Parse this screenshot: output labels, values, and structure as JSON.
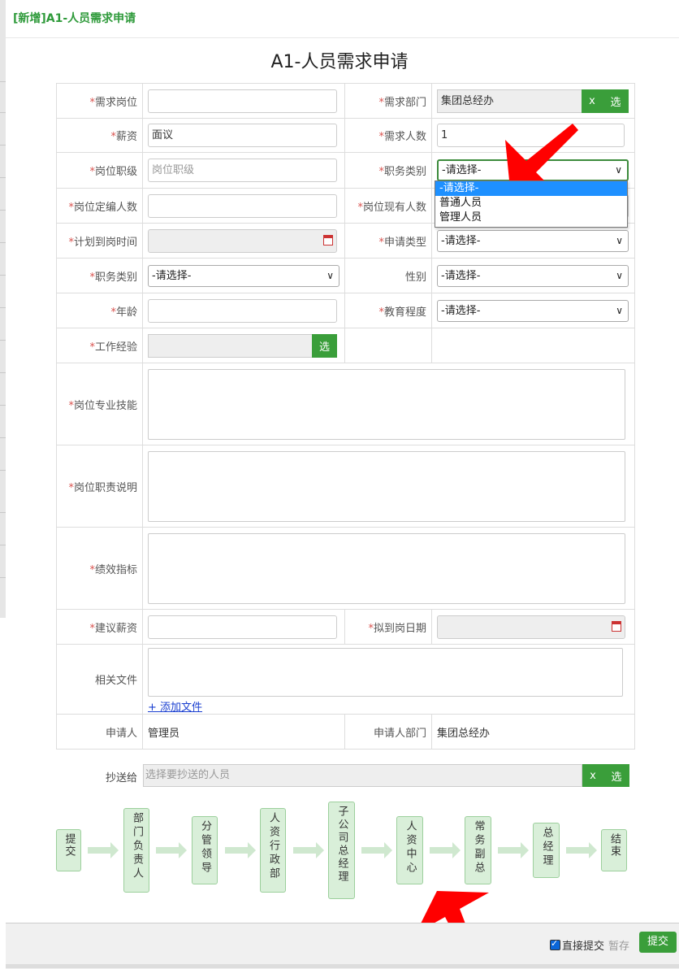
{
  "dialog_title": "[新增]A1-人员需求申请",
  "form_title": "A1-人员需求申请",
  "required_mark": "*",
  "fields": {
    "position": {
      "label": "需求岗位",
      "value": ""
    },
    "department": {
      "label": "需求部门",
      "value": "集团总经办",
      "clear": "x",
      "select": "选"
    },
    "salary": {
      "label": "薪资",
      "value": "面议"
    },
    "headcount": {
      "label": "需求人数",
      "value": "1"
    },
    "job_grade": {
      "label": "岗位职级",
      "placeholder": "岗位职级"
    },
    "duty_type": {
      "label": "职务类别",
      "value": "-请选择-"
    },
    "quota": {
      "label": "岗位定编人数",
      "value": ""
    },
    "current_count": {
      "label": "岗位现有人数",
      "value": ""
    },
    "planned_date": {
      "label": "计划到岗时间",
      "value": ""
    },
    "apply_type": {
      "label": "申请类型",
      "value": "-请选择-"
    },
    "duty_type2": {
      "label": "职务类别",
      "value": "-请选择-"
    },
    "gender": {
      "label": "性别",
      "value": "-请选择-"
    },
    "age": {
      "label": "年龄",
      "value": ""
    },
    "education": {
      "label": "教育程度",
      "value": "-请选择-"
    },
    "experience": {
      "label": "工作经验",
      "select": "选"
    },
    "skills": {
      "label": "岗位专业技能"
    },
    "duties": {
      "label": "岗位职责说明"
    },
    "kpi": {
      "label": "绩效指标"
    },
    "suggested_salary": {
      "label": "建议薪资",
      "value": ""
    },
    "proposed_date": {
      "label": "拟到岗日期",
      "value": ""
    },
    "files": {
      "label": "相关文件",
      "add_link": "+ 添加文件"
    },
    "applicant": {
      "label": "申请人",
      "value": "管理员"
    },
    "applicant_dept": {
      "label": "申请人部门",
      "value": "集团总经办"
    }
  },
  "dropdown_options": [
    "-请选择-",
    "普通人员",
    "管理人员"
  ],
  "cc": {
    "label": "抄送给",
    "placeholder": "选择要抄送的人员",
    "clear": "x",
    "select": "选"
  },
  "flow_steps": [
    "提交",
    "部门负责人",
    "分管领导",
    "人资行政部",
    "子公司总经理",
    "人资中心",
    "常务副总",
    "总经理",
    "结束"
  ],
  "footer": {
    "direct_submit": "直接提交",
    "draft": "暂存",
    "submit": "提交"
  },
  "colors": {
    "accent": "#3a9e3a",
    "required": "#d9534f",
    "highlight": "#1e90ff",
    "annotation": "#ff0000"
  }
}
